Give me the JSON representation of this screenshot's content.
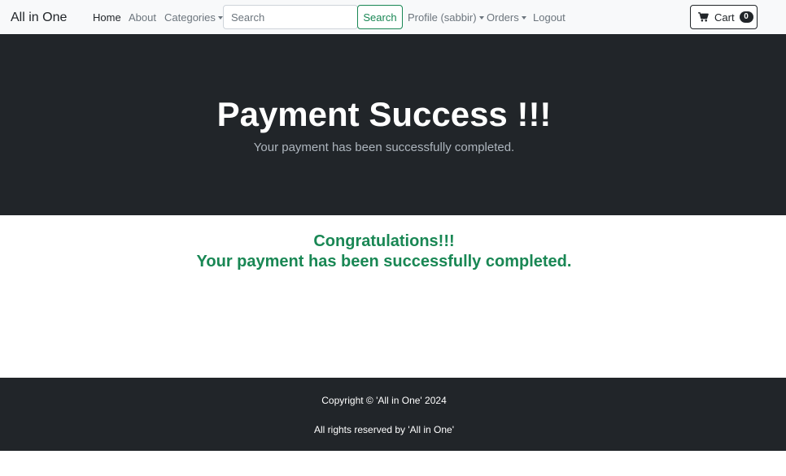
{
  "navbar": {
    "brand": "All in One",
    "links": {
      "home": "Home",
      "about": "About",
      "categories": "Categories",
      "profile": "Profile (sabbir)",
      "orders": "Orders",
      "logout": "Logout"
    },
    "search": {
      "placeholder": "Search",
      "value": "",
      "button_label": "Search"
    },
    "cart": {
      "label": "Cart",
      "count": "0"
    }
  },
  "hero": {
    "title": "Payment Success !!!",
    "subtitle": "Your payment has been successfully completed."
  },
  "main": {
    "congrats_line1": "Congratulations!!!",
    "congrats_line2": "Your payment has been successfully completed."
  },
  "footer": {
    "copyright": "Copyright © 'All in One' 2024",
    "rights": "All rights reserved by 'All in One'"
  },
  "colors": {
    "dark": "#212529",
    "success": "#198754",
    "navbar_bg": "#f8f9fa",
    "muted": "#6c757d"
  }
}
